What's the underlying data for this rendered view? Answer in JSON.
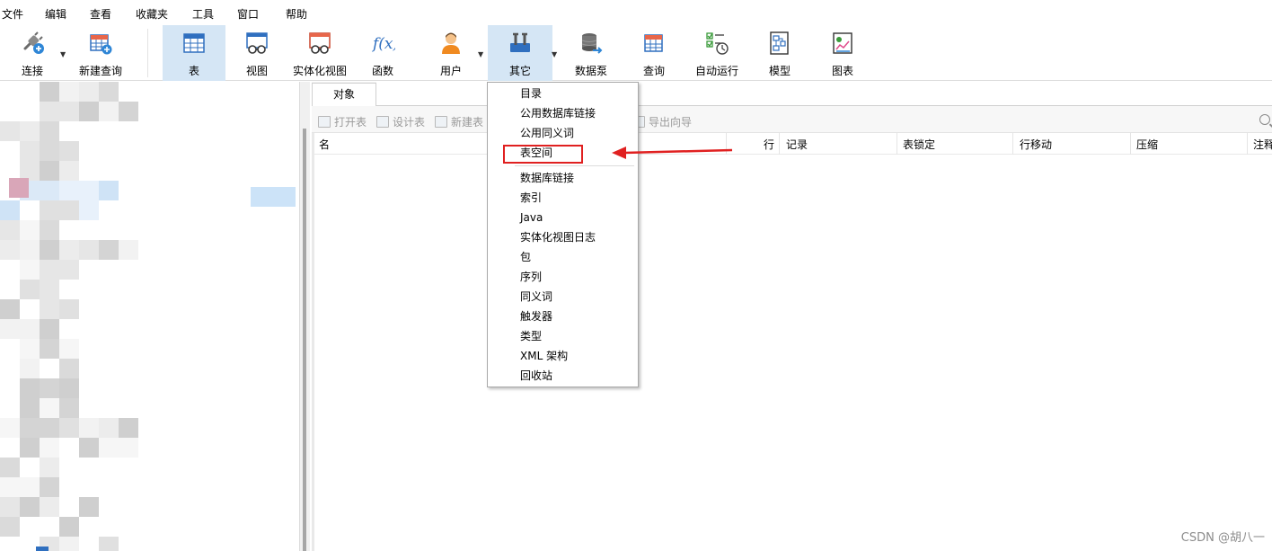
{
  "menubar": {
    "items": [
      "文件",
      "编辑",
      "查看",
      "收藏夹",
      "工具",
      "窗口",
      "帮助"
    ]
  },
  "toolbar": {
    "buttons": [
      {
        "label": "连接",
        "icon": "connect-plug-icon"
      },
      {
        "label": "新建查询",
        "icon": "new-query-icon"
      },
      {
        "label": "表",
        "icon": "table-icon"
      },
      {
        "label": "视图",
        "icon": "view-glasses-icon"
      },
      {
        "label": "实体化视图",
        "icon": "materialized-view-icon"
      },
      {
        "label": "函数",
        "icon": "function-fx-icon"
      },
      {
        "label": "用户",
        "icon": "user-icon"
      },
      {
        "label": "其它",
        "icon": "tools-icon"
      },
      {
        "label": "数据泵",
        "icon": "data-pump-icon"
      },
      {
        "label": "查询",
        "icon": "query-icon"
      },
      {
        "label": "自动运行",
        "icon": "auto-run-icon"
      },
      {
        "label": "模型",
        "icon": "model-icon"
      },
      {
        "label": "图表",
        "icon": "chart-icon"
      }
    ]
  },
  "objects_tab": {
    "label": "对象"
  },
  "object_toolbar": {
    "open_table": "打开表",
    "design_table": "设计表",
    "new_table": "新建表",
    "export_wizard": "导出向导"
  },
  "columns": [
    "名",
    "行",
    "记录",
    "表锁定",
    "行移动",
    "压缩",
    "注释"
  ],
  "dropdown": {
    "items": [
      "目录",
      "公用数据库链接",
      "公用同义词",
      "表空间",
      "数据库链接",
      "索引",
      "Java",
      "实体化视图日志",
      "包",
      "序列",
      "同义词",
      "触发器",
      "类型",
      "XML 架构",
      "回收站"
    ],
    "highlighted": "表空间"
  },
  "colors": {
    "accent_selected": "#d5e6f5",
    "annotation_red": "#e02020"
  },
  "watermark": "CSDN @胡八一"
}
